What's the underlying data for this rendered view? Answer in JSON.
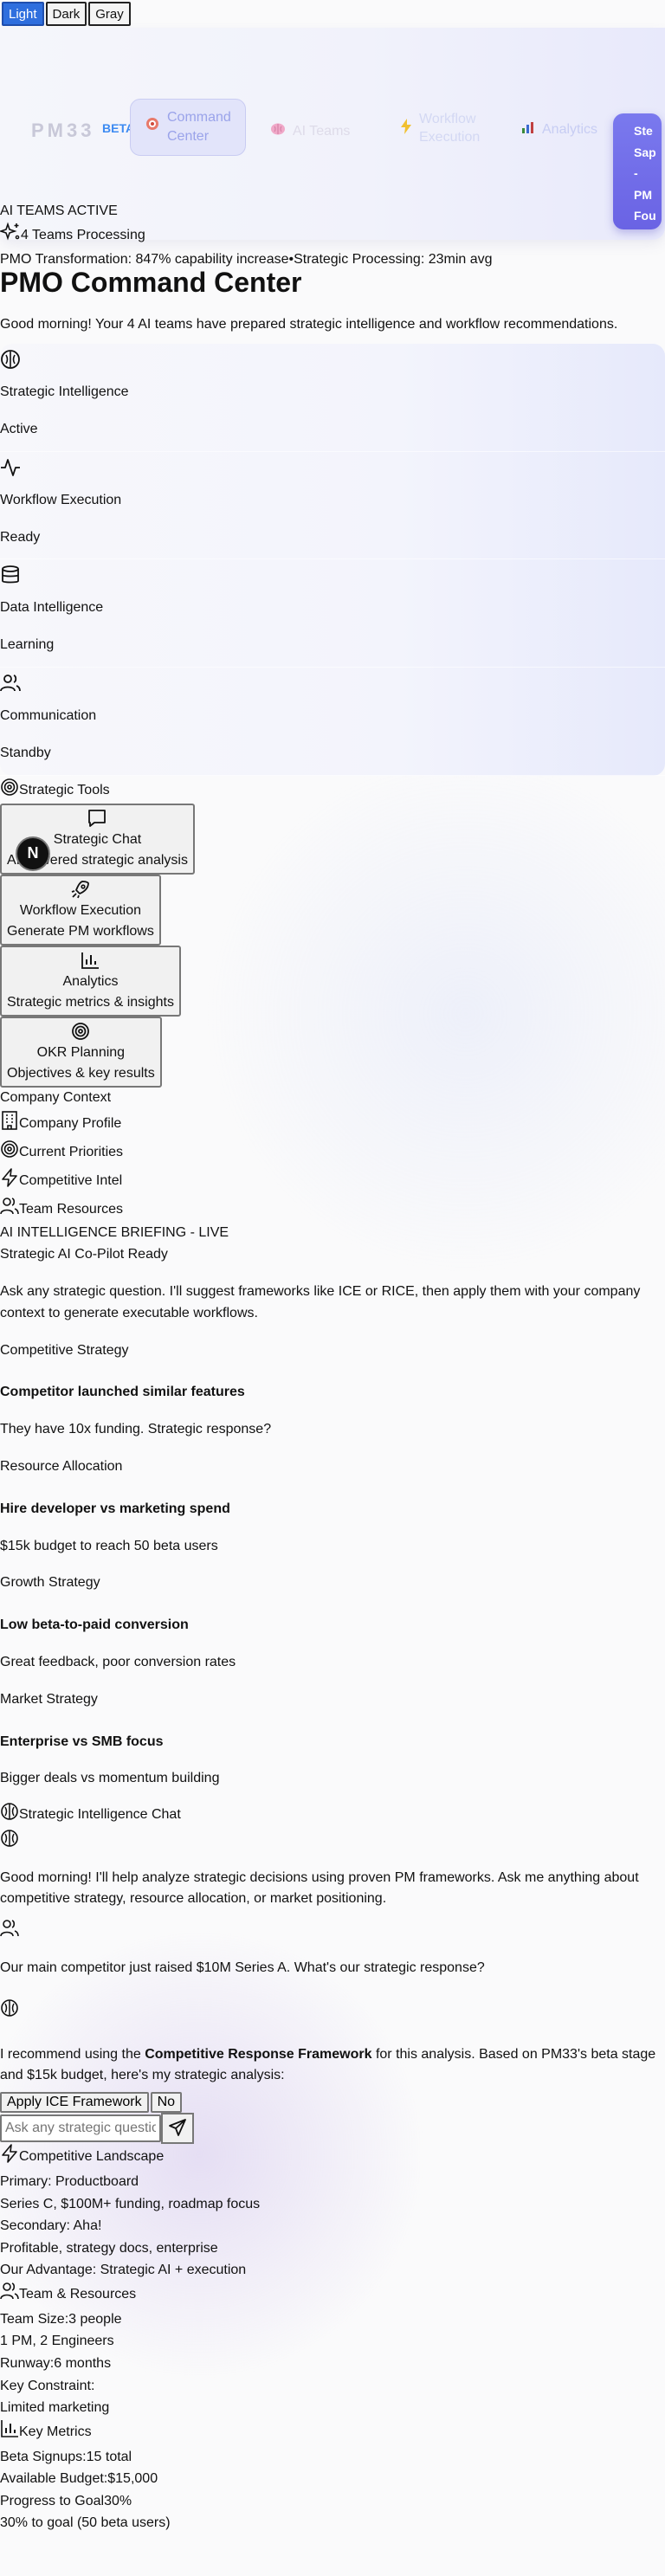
{
  "theme": {
    "options": [
      "Light",
      "Dark",
      "Gray"
    ],
    "selected": "Light"
  },
  "nav": {
    "logo": "PM33",
    "beta": "BETA",
    "items": [
      {
        "label_line1": "Command",
        "label_line2": "Center",
        "icon": "target-icon"
      },
      {
        "label": "AI Teams",
        "icon": "brain-icon"
      },
      {
        "label_line1": "Workflow",
        "label_line2": "Execution",
        "icon": "lightning-icon"
      },
      {
        "label": "Analytics",
        "icon": "bar-chart-icon"
      }
    ],
    "step_button": [
      "Ste",
      "Sap",
      "-",
      "PM",
      "Fou"
    ]
  },
  "status": {
    "ai_teams": "AI TEAMS ACTIVE",
    "processing": "4 Teams Processing",
    "transformation": "PMO Transformation: 847% capability increase",
    "separator": "•",
    "processing_time": "Strategic Processing: 23min avg"
  },
  "header": {
    "title": "PMO Command Center",
    "greeting": "Good morning! Your 4 AI teams have prepared strategic intelligence and workflow recommendations."
  },
  "teams": [
    {
      "name": "Strategic Intelligence",
      "status": "Active",
      "icon": "brain-icon"
    },
    {
      "name": "Workflow Execution",
      "status": "Ready",
      "icon": "activity-icon"
    },
    {
      "name": "Data Intelligence",
      "status": "Learning",
      "icon": "database-icon"
    },
    {
      "name": "Communication",
      "status": "Standby",
      "icon": "users-icon"
    }
  ],
  "tools": {
    "heading": "Strategic Tools",
    "items": [
      {
        "title": "Strategic Chat",
        "desc": "AI-powered strategic analysis",
        "icon": "chat-icon"
      },
      {
        "title": "Workflow Execution",
        "desc": "Generate PM workflows",
        "icon": "rocket-icon"
      },
      {
        "title": "Analytics",
        "desc": "Strategic metrics & insights",
        "icon": "bar-chart-icon"
      },
      {
        "title": "OKR Planning",
        "desc": "Objectives & key results",
        "icon": "target-icon"
      }
    ],
    "avatar": "N"
  },
  "context": {
    "heading": "Company Context",
    "items": [
      {
        "label": "Company Profile",
        "icon": "building-icon"
      },
      {
        "label": "Current Priorities",
        "icon": "target-icon"
      },
      {
        "label": "Competitive Intel",
        "icon": "lightning-icon"
      },
      {
        "label": "Team Resources",
        "icon": "users-icon"
      }
    ]
  },
  "briefing": {
    "label": "AI INTELLIGENCE BRIEFING - LIVE",
    "copilot": "Strategic AI Co-Pilot Ready",
    "intro": "Ask any strategic question. I'll suggest frameworks like ICE or RICE, then apply them with your company context to generate executable workflows.",
    "scenarios": [
      {
        "category": "Competitive Strategy",
        "title": "Competitor launched similar features",
        "desc": "They have 10x funding. Strategic response?"
      },
      {
        "category": "Resource Allocation",
        "title": "Hire developer vs marketing spend",
        "desc": "$15k budget to reach 50 beta users"
      },
      {
        "category": "Growth Strategy",
        "title": "Low beta-to-paid conversion",
        "desc": "Great feedback, poor conversion rates"
      },
      {
        "category": "Market Strategy",
        "title": "Enterprise vs SMB focus",
        "desc": "Bigger deals vs momentum building"
      }
    ]
  },
  "chat": {
    "heading": "Strategic Intelligence Chat",
    "ai_greeting": "Good morning! I'll help analyze strategic decisions using proven PM frameworks. Ask me anything about competitive strategy, resource allocation, or market positioning.",
    "user_message": "Our main competitor just raised $10M Series A. What's our strategic response?",
    "ai_reply_pre": "I recommend using the ",
    "ai_reply_bold": "Competitive Response Framework",
    "ai_reply_post": " for this analysis. Based on PM33's beta stage and $15k budget, here's my strategic analysis:",
    "apply_button": "Apply ICE Framework",
    "no_button": "No",
    "input_placeholder": "Ask any strategic question..."
  },
  "landscape": {
    "heading": "Competitive Landscape",
    "lines": [
      "Primary: Productboard",
      "Series C, $100M+ funding, roadmap focus",
      "Secondary: Aha!",
      "Profitable, strategy docs, enterprise",
      "Our Advantage: Strategic AI + execution"
    ]
  },
  "team_resources": {
    "heading": "Team & Resources",
    "team_size_label": "Team Size:",
    "team_size_value": "3 people",
    "composition": "1 PM, 2 Engineers",
    "runway_label": "Runway:",
    "runway_value": "6 months",
    "constraint_label": "Key Constraint:",
    "constraint_value": "Limited marketing"
  },
  "metrics": {
    "heading": "Key Metrics",
    "beta_label": "Beta Signups:",
    "beta_value": "15 total",
    "budget_label": "Available Budget:",
    "budget_value": "$15,000",
    "progress_label": "Progress to Goal",
    "progress_value": "30%",
    "progress_note": "30% to goal (50 beta users)"
  },
  "colors": {
    "accent": "#6a63e4",
    "theme_active": "#2f6fde",
    "beta": "#3d8bf2"
  }
}
